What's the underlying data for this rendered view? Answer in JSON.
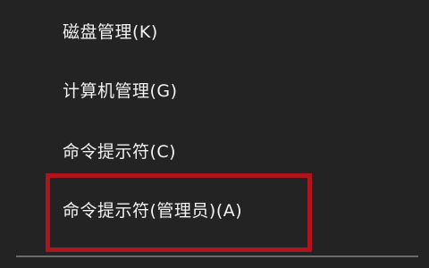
{
  "context_menu": {
    "items": [
      {
        "label": "磁盘管理(K)"
      },
      {
        "label": "计算机管理(G)"
      },
      {
        "label": "命令提示符(C)"
      },
      {
        "label": "命令提示符(管理员)(A)"
      }
    ]
  },
  "colors": {
    "background": "#232323",
    "text": "#f2f2f2",
    "highlight_border": "#b0141d",
    "separator": "#6a6a6a"
  }
}
